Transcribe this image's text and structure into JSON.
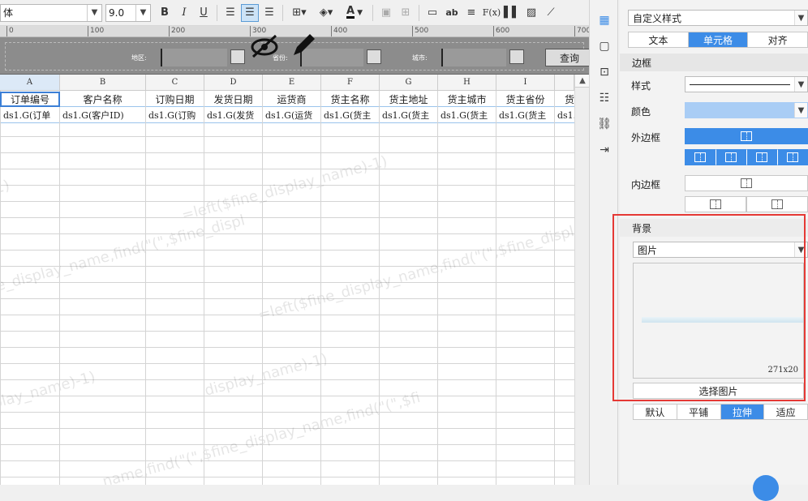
{
  "toolbar": {
    "font_name": "体",
    "font_size": "9.0",
    "bold": "B",
    "italic": "I",
    "underline": "U",
    "text_color": "A",
    "ab": "ab",
    "fx": "F(x)"
  },
  "ruler": {
    "ticks": [
      "0",
      "100",
      "200",
      "300",
      "400",
      "500",
      "600",
      "700"
    ]
  },
  "param_band": {
    "region_label": "地区:",
    "province_label": "省份:",
    "city_label": "城市:",
    "query_button": "查询"
  },
  "sheet": {
    "columns": [
      "A",
      "B",
      "C",
      "D",
      "E",
      "F",
      "G",
      "H",
      "I",
      ""
    ],
    "header_row": [
      "订单编号",
      "客户名称",
      "订购日期",
      "发货日期",
      "运货商",
      "货主名称",
      "货主地址",
      "货主城市",
      "货主省份",
      "货"
    ],
    "data_row": [
      "ds1.G(订单",
      "ds1.G(客户ID)",
      "ds1.G(订购",
      "ds1.G(发货",
      "ds1.G(运货",
      "ds1.G(货主",
      "ds1.G(货主",
      "ds1.G(货主",
      "ds1.G(货主",
      "ds1."
    ],
    "watermark_1": "=left($fine_display_name,find(\"(\",$fine_display_name)-1)",
    "watermark_2": "=left($fine_display_name,find(\"(\",$fine_display_name)-1)"
  },
  "panel": {
    "style_preset": "自定义样式",
    "tabs": [
      "文本",
      "单元格",
      "对齐"
    ],
    "active_tab": "单元格",
    "border_section": "边框",
    "style_label": "样式",
    "color_label": "颜色",
    "outer_border_label": "外边框",
    "inner_border_label": "内边框",
    "background_section": "背景",
    "background_type": "图片",
    "image_size": "271x20",
    "choose_image_button": "选择图片",
    "fill_modes": [
      "默认",
      "平铺",
      "拉伸",
      "适应"
    ],
    "active_fill_mode": "拉伸",
    "border_color": "#a9cdf5",
    "accent_color": "#3c8ce7"
  }
}
